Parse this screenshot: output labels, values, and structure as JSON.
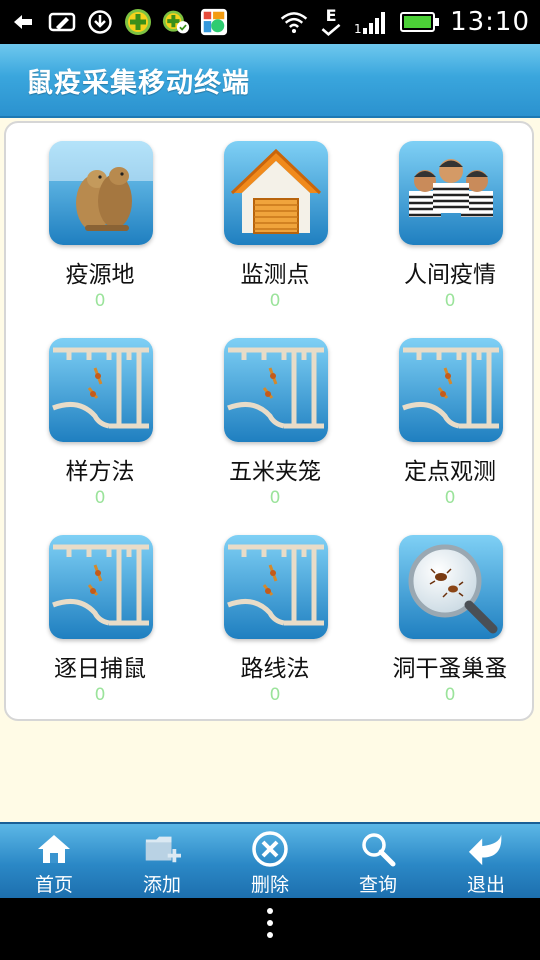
{
  "status_bar": {
    "time": "13:10",
    "network_label": "E",
    "icons": [
      "usb-icon",
      "edit-icon",
      "download-icon",
      "plus-app-icon",
      "plus-app-check-icon",
      "store-icon",
      "wifi-icon",
      "network-check-icon",
      "signal-icon",
      "battery-icon"
    ]
  },
  "header": {
    "title": "鼠疫采集移动终端"
  },
  "grid": [
    {
      "label": "疫源地",
      "count": "0",
      "icon": "marmot-icon"
    },
    {
      "label": "监测点",
      "count": "0",
      "icon": "house-icon"
    },
    {
      "label": "人间疫情",
      "count": "0",
      "icon": "people-icon"
    },
    {
      "label": "样方法",
      "count": "0",
      "icon": "trap-icon"
    },
    {
      "label": "五米夹笼",
      "count": "0",
      "icon": "trap-icon"
    },
    {
      "label": "定点观测",
      "count": "0",
      "icon": "trap-icon"
    },
    {
      "label": "逐日捕鼠",
      "count": "0",
      "icon": "trap-icon"
    },
    {
      "label": "路线法",
      "count": "0",
      "icon": "trap-icon"
    },
    {
      "label": "洞干蚤巢蚤",
      "count": "0",
      "icon": "magnifier-flea-icon"
    }
  ],
  "bottom_nav": [
    {
      "label": "首页",
      "icon": "home-icon"
    },
    {
      "label": "添加",
      "icon": "add-folder-icon"
    },
    {
      "label": "删除",
      "icon": "delete-icon"
    },
    {
      "label": "查询",
      "icon": "search-icon"
    },
    {
      "label": "退出",
      "icon": "back-arrow-icon"
    }
  ],
  "colors": {
    "title_bar": "#3aa6dd",
    "nav_bar": "#2b88c6",
    "count_text": "#9be39b",
    "page_background": "#fffbe6"
  }
}
